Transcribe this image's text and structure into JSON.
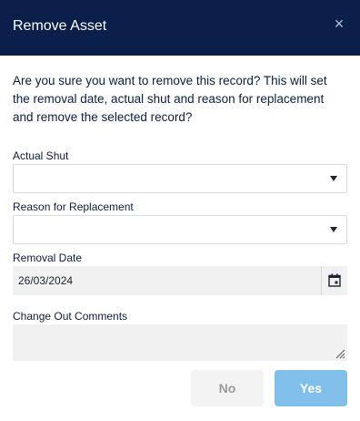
{
  "dialog": {
    "title": "Remove Asset",
    "close_icon": "close-icon",
    "message": "Are you sure you want to remove this record? This will set the removal date, actual shut and reason for replacement and remove the selected record?"
  },
  "form": {
    "actual_shut": {
      "label": "Actual Shut",
      "value": ""
    },
    "reason": {
      "label": "Reason for Replacement",
      "value": ""
    },
    "removal_date": {
      "label": "Removal Date",
      "value": "26/03/2024",
      "icon": "calendar-icon"
    },
    "comments": {
      "label": "Change Out Comments",
      "value": ""
    }
  },
  "buttons": {
    "no": "No",
    "yes": "Yes"
  },
  "colors": {
    "header_bg": "#0b1f4b",
    "yes_button": "#7fbfe9",
    "no_button": "#f3f3f3",
    "text": "#0b1e3f"
  }
}
